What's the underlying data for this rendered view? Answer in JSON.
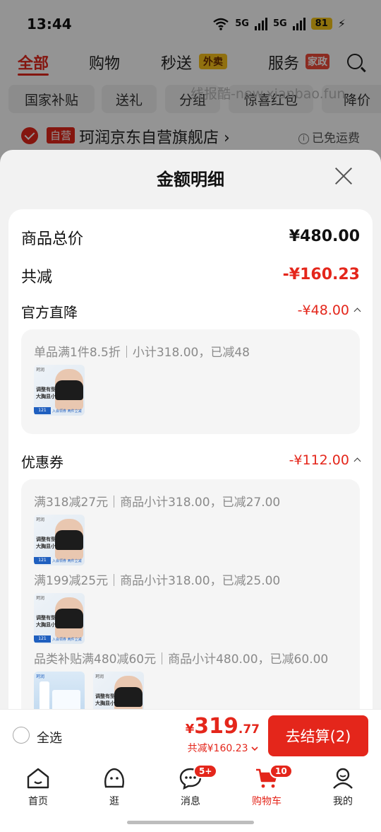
{
  "status": {
    "time": "13:44",
    "net1": "5G",
    "net2": "5G",
    "battery": "81",
    "charging": "⚡"
  },
  "topnav": {
    "tabs": [
      "全部",
      "购物",
      "秒送",
      "服务"
    ],
    "badge_waimai": "外卖",
    "badge_home": "家政"
  },
  "chips": [
    "国家补贴",
    "送礼",
    "分组",
    "惊喜红包",
    "降价"
  ],
  "watermark": "线报酷-new.xianbao.fun",
  "store": {
    "badge": "自营",
    "name": "珂润京东自营旗舰店",
    "arrow": "›",
    "shipping": "已免运费",
    "info": "i"
  },
  "sheet": {
    "title": "金额明细",
    "goods_total_label": "商品总价",
    "goods_total_value": "¥480.00",
    "total_off_label": "共减",
    "total_off_value": "-¥160.23",
    "official": {
      "label": "官方直降",
      "value": "-¥48.00",
      "details": [
        "单品满1件8.5折｜小计318.00，已减48"
      ]
    },
    "coupon": {
      "label": "优惠券",
      "value": "-¥112.00",
      "details": [
        "满318减27元｜商品小计318.00，已减27.00",
        "满199减25元｜商品小计318.00，已减25.00",
        "品类补贴满480减60元｜商品小计480.00，已减60.00"
      ]
    },
    "thumb_text": {
      "brand": "珂润",
      "line1": "调整有型",
      "line2": "大胸显小",
      "price": "121",
      "foot": "入会领券 两件立减"
    }
  },
  "checkout": {
    "select_all": "全选",
    "currency": "¥",
    "total_int": "319",
    "total_dec": ".77",
    "total_off": "共减¥160.23",
    "pay_button": "去结算(2)"
  },
  "tabbar": {
    "items": [
      "首页",
      "逛",
      "消息",
      "购物车",
      "我的"
    ],
    "msg_badge": "5+",
    "cart_badge": "10"
  },
  "colors": {
    "accent": "#e4261b",
    "sheet_bg": "#f2f2f2",
    "badge_yellow": "#f9c21a"
  }
}
